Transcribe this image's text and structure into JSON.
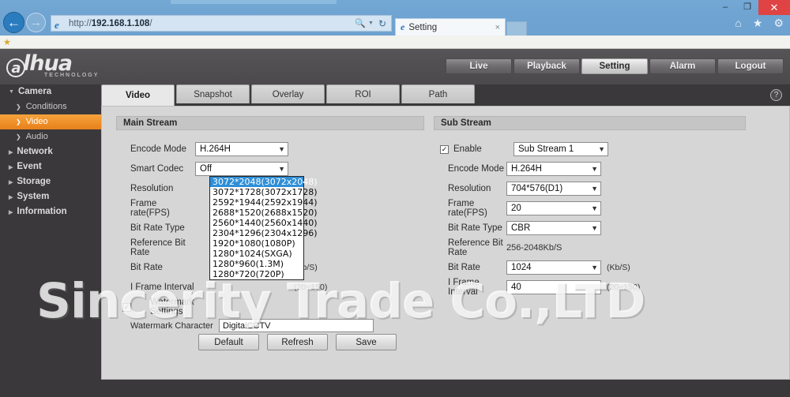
{
  "browser": {
    "url_prefix": "http://",
    "url_host": "192.168.1.108",
    "url_suffix": "/",
    "back_icon": "back-arrow-icon",
    "forward_icon": "forward-arrow-icon",
    "search_icon": "search-icon",
    "refresh_icon": "refresh-icon",
    "caret_icon": "chevron-down-icon",
    "tab_title": "Setting",
    "tab_close": "×",
    "home_icon": "home-icon",
    "favorites_icon": "star-icon",
    "tools_icon": "gear-icon",
    "minimize": "–",
    "maximize": "❐",
    "close": "✕",
    "favbar_star": "★"
  },
  "header": {
    "logo_mark": "a",
    "logo_text": "lhua",
    "logo_sub": "TECHNOLOGY",
    "nav": [
      {
        "label": "Live",
        "active": false
      },
      {
        "label": "Playback",
        "active": false
      },
      {
        "label": "Setting",
        "active": true
      },
      {
        "label": "Alarm",
        "active": false
      },
      {
        "label": "Logout",
        "active": false
      }
    ]
  },
  "sidebar": {
    "groups": [
      {
        "label": "Camera",
        "expanded": true,
        "items": [
          {
            "label": "Conditions",
            "active": false
          },
          {
            "label": "Video",
            "active": true
          },
          {
            "label": "Audio",
            "active": false
          }
        ]
      },
      {
        "label": "Network",
        "expanded": false,
        "items": []
      },
      {
        "label": "Event",
        "expanded": false,
        "items": []
      },
      {
        "label": "Storage",
        "expanded": false,
        "items": []
      },
      {
        "label": "System",
        "expanded": false,
        "items": []
      },
      {
        "label": "Information",
        "expanded": false,
        "items": []
      }
    ]
  },
  "tabs": [
    {
      "label": "Video",
      "active": true
    },
    {
      "label": "Snapshot",
      "active": false
    },
    {
      "label": "Overlay",
      "active": false
    },
    {
      "label": "ROI",
      "active": false
    },
    {
      "label": "Path",
      "active": false
    }
  ],
  "help_icon_label": "?",
  "main_stream": {
    "title": "Main Stream",
    "encode_mode": {
      "label": "Encode Mode",
      "value": "H.264H"
    },
    "smart_codec": {
      "label": "Smart Codec",
      "value": "Off"
    },
    "resolution": {
      "label": "Resolution",
      "value": "3072*2048(3072x2048)"
    },
    "frame_rate": {
      "label": "Frame rate(FPS)",
      "value": ""
    },
    "bit_rate_type": {
      "label": "Bit Rate Type",
      "value": ""
    },
    "reference_bit_rate": {
      "label": "Reference Bit Rate",
      "value": ""
    },
    "bit_rate": {
      "label": "Bit Rate",
      "value": "",
      "suffix": "(Kb/S)"
    },
    "i_frame_interval": {
      "label": "I Frame Interval",
      "value": "",
      "suffix": "(20~150)"
    },
    "watermark_settings": {
      "label": "Watermark Settings",
      "checked": true
    },
    "watermark_character": {
      "label": "Watermark Character",
      "value": "DigitalCCTV"
    },
    "resolution_options": [
      {
        "label": "3072*2048(3072x2048)",
        "selected": true
      },
      {
        "label": "3072*1728(3072x1728)",
        "selected": false
      },
      {
        "label": "2592*1944(2592x1944)",
        "selected": false
      },
      {
        "label": "2688*1520(2688x1520)",
        "selected": false
      },
      {
        "label": "2560*1440(2560x1440)",
        "selected": false
      },
      {
        "label": "2304*1296(2304x1296)",
        "selected": false
      },
      {
        "label": "1920*1080(1080P)",
        "selected": false
      },
      {
        "label": "1280*1024(SXGA)",
        "selected": false
      },
      {
        "label": "1280*960(1.3M)",
        "selected": false
      },
      {
        "label": "1280*720(720P)",
        "selected": false
      }
    ]
  },
  "sub_stream": {
    "title": "Sub Stream",
    "enable": {
      "label": "Enable",
      "checked": true,
      "value": "Sub Stream 1"
    },
    "encode_mode": {
      "label": "Encode Mode",
      "value": "H.264H"
    },
    "resolution": {
      "label": "Resolution",
      "value": "704*576(D1)"
    },
    "frame_rate": {
      "label": "Frame rate(FPS)",
      "value": "20"
    },
    "bit_rate_type": {
      "label": "Bit Rate Type",
      "value": "CBR"
    },
    "reference_bit_rate": {
      "label": "Reference Bit Rate",
      "value": "256-2048Kb/S"
    },
    "bit_rate": {
      "label": "Bit Rate",
      "value": "1024",
      "suffix": "(Kb/S)"
    },
    "i_frame_interval": {
      "label": "I Frame Interval",
      "value": "40",
      "suffix": "(20~150)"
    }
  },
  "actions": {
    "default": "Default",
    "refresh": "Refresh",
    "save": "Save"
  },
  "overlay_watermark": "Sincerity Trade Co.,LTD",
  "colors": {
    "accent_orange": "#e8801a",
    "panel_gray": "#d6d6d6",
    "chrome_blue": "#6fa3d1",
    "dropdown_highlight": "#2f8fd8",
    "dark_bg": "#3a383a"
  }
}
